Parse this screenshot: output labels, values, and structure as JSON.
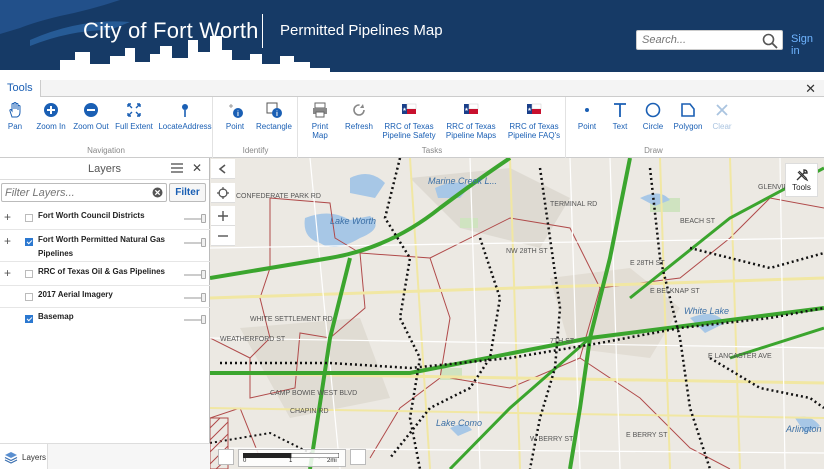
{
  "header": {
    "city_title": "City of Fort Worth",
    "subtitle": "Permitted Pipelines Map",
    "search_placeholder": "Search...",
    "sign_in": "Sign in"
  },
  "toolbar": {
    "tab_label": "Tools",
    "groups": [
      {
        "name": "Navigation",
        "buttons": [
          "Pan",
          "Zoom In",
          "Zoom Out",
          "Full Extent",
          "LocateAddress"
        ]
      },
      {
        "name": "Identify",
        "buttons": [
          "Point",
          "Rectangle"
        ]
      },
      {
        "name": "Tasks",
        "buttons": [
          "Print Map",
          "Refresh",
          "RRC of Texas Pipeline Safety",
          "RRC of Texas Pipeline Maps",
          "RRC of Texas Pipeline FAQ's"
        ]
      },
      {
        "name": "Draw",
        "buttons": [
          "Point",
          "Text",
          "Circle",
          "Polygon",
          "Clear"
        ]
      }
    ],
    "colors": {
      "accent": "#1a5fb4",
      "header_bg": "#163a66"
    }
  },
  "layers_panel": {
    "title": "Layers",
    "filter_placeholder": "Filter Layers...",
    "filter_button": "Filter",
    "layers": [
      {
        "name": "Fort Worth Council Districts",
        "checked": false,
        "expandable": true
      },
      {
        "name": "Fort Worth Permitted Natural Gas Pipelines",
        "checked": true,
        "expandable": true
      },
      {
        "name": "RRC of Texas Oil & Gas Pipelines",
        "checked": false,
        "expandable": true
      },
      {
        "name": "2017 Aerial Imagery",
        "checked": false,
        "expandable": false
      },
      {
        "name": "Basemap",
        "checked": true,
        "expandable": false
      }
    ],
    "footer_tab": "Layers"
  },
  "map": {
    "tools_label": "Tools",
    "scale": {
      "ticks": [
        "0",
        "1",
        "2mi"
      ]
    },
    "labels": {
      "marine_creek": "Marine Creek L...",
      "lake_worth": "Lake Worth",
      "white_lake": "White Lake",
      "lake_como": "Lake Como",
      "arlington": "Arlington",
      "confederate_park": "CONFEDERATE PARK RD",
      "terminal_rd": "TERMINAL RD",
      "nw_28th": "NW 28TH ST",
      "e_28th": "E 28TH ST",
      "e_belknap": "E BELKNAP ST",
      "glenview": "GLENVIEW DR",
      "e_lancaster": "E LANCASTER AVE",
      "e_berry": "E BERRY ST",
      "w_berry": "W BERRY ST",
      "camp_bowie": "CAMP BOWIE WEST BLVD",
      "weatherford": "WEATHERFORD ST",
      "chapin": "CHAPIN RD",
      "seventh": "7TH ST",
      "white_settlement": "WHITE SETTLEMENT RD",
      "beach": "BEACH ST"
    }
  }
}
